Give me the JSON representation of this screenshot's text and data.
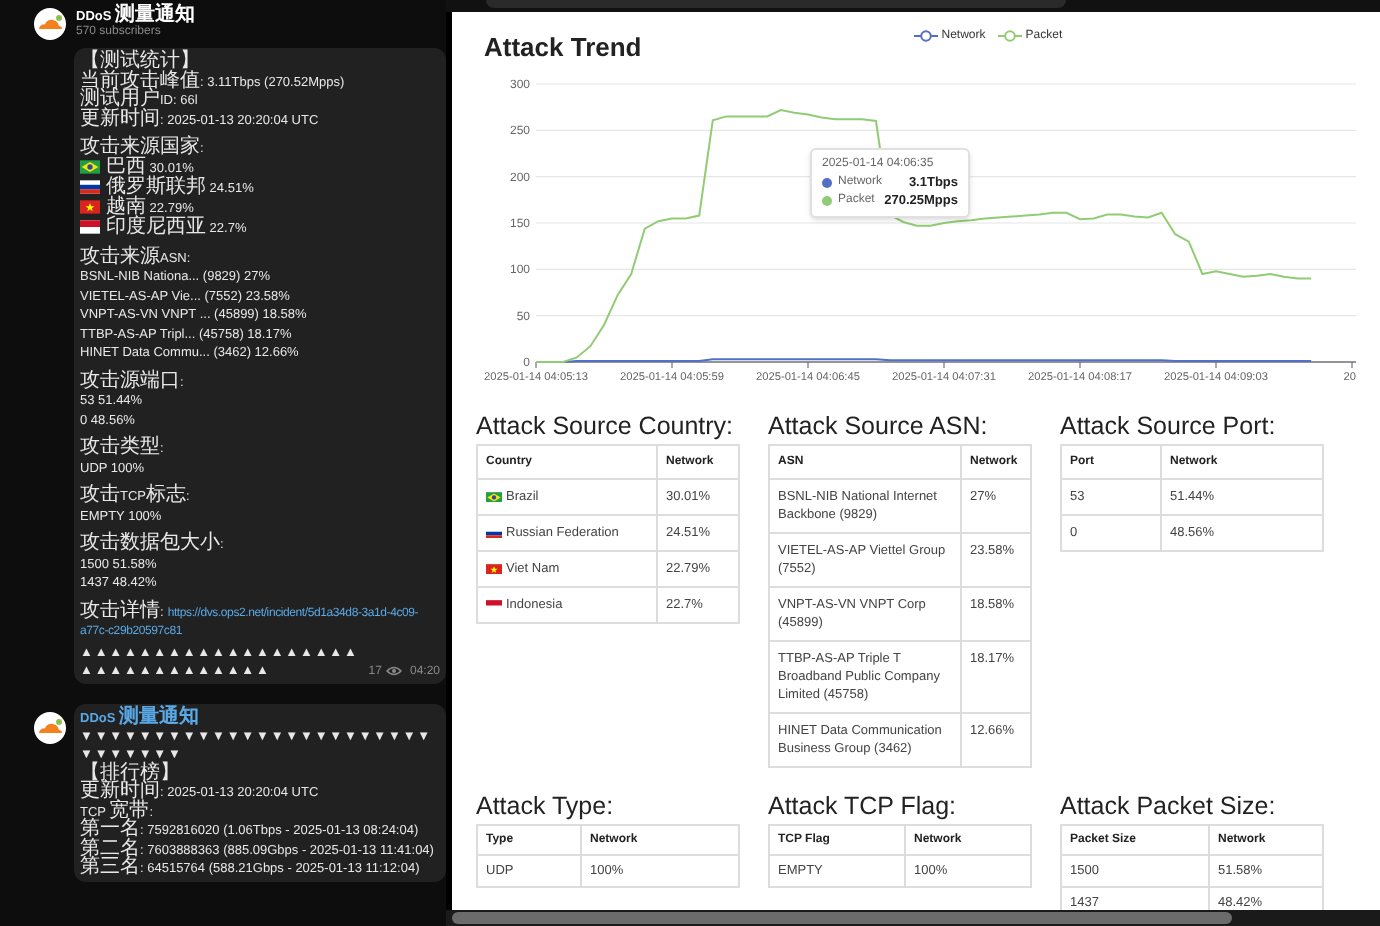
{
  "chat": {
    "channel": {
      "name": "DDoS 测量通知",
      "subscribers": "570 subscribers"
    },
    "messages": [
      {
        "sections": [
          [
            {
              "text": "【测试统计】"
            },
            {
              "text": "当前攻击峰值: 3.11Tbps (270.52Mpps)"
            },
            {
              "text": "测试用户ID: 66l"
            },
            {
              "text": "更新时间: 2025-01-13 20:20:04 UTC"
            }
          ],
          [
            {
              "text": "攻击来源国家:"
            },
            {
              "text": "巴西 30.01%",
              "kind": "brazil"
            },
            {
              "text": "俄罗斯联邦 24.51%",
              "kind": "russia"
            },
            {
              "text": "越南 22.79%",
              "kind": "vietnam"
            },
            {
              "text": "印度尼西亚 22.7%",
              "kind": "indonesia"
            }
          ],
          [
            {
              "text": "攻击来源ASN:"
            },
            {
              "text": "BSNL-NIB Nationa... (9829) 27%"
            },
            {
              "text": "VIETEL-AS-AP Vie... (7552) 23.58%"
            },
            {
              "text": "VNPT-AS-VN VNPT ... (45899) 18.58%"
            },
            {
              "text": "TTBP-AS-AP Tripl... (45758) 18.17%"
            },
            {
              "text": "HINET Data Commu... (3462) 12.66%"
            }
          ],
          [
            {
              "text": "攻击源端口:"
            },
            {
              "text": "53 51.44%"
            },
            {
              "text": "0 48.56%"
            }
          ],
          [
            {
              "text": "攻击类型:"
            },
            {
              "text": "UDP 100%"
            }
          ],
          [
            {
              "text": "攻击TCP标志:"
            },
            {
              "text": "EMPTY 100%"
            }
          ],
          [
            {
              "text": "攻击数据包大小:"
            },
            {
              "text": "1500 51.58%"
            },
            {
              "text": "1437 48.42%"
            }
          ],
          [
            {
              "text": "攻击详情:",
              "link": [
                "https://dvs.ops2.net/incident/5d1a34d8-3a1d-4c09-",
                "a77c-c29b20597c81"
              ]
            },
            {
              "text": "▲▲▲▲▲▲▲▲▲▲▲▲▲▲▲▲▲▲▲▲▲▲▲▲▲▲▲▲▲▲▲▲"
            }
          ]
        ],
        "views": "17",
        "time": "04:20"
      },
      {
        "author": "DDoS 测量通知",
        "sections": [
          [
            {
              "text": "▼▼▼▼▼▼▼▼▼▼▼▼▼▼▼▼▼▼▼▼▼▼▼▼▼▼▼▼▼▼▼"
            },
            {
              "text": "【排行榜】"
            },
            {
              "text": "更新时间: 2025-01-13 20:20:04 UTC"
            },
            {
              "text": "TCP 宽带:"
            },
            {
              "text": "第一名: 7592816020 (1.06Tbps - 2025-01-13 08:24:04)"
            },
            {
              "text": "第二名: 7603888363 (885.09Gbps - 2025-01-13 11:41:04)"
            },
            {
              "text": "第三名: 64515764 (588.21Gbps - 2025-01-13 11:12:04)"
            }
          ]
        ]
      }
    ]
  },
  "report": {
    "trend": {
      "title": "Attack Trend",
      "chart_data": {
        "type": "line",
        "categories": [
          "2025-01-14 04:05:13",
          null,
          null,
          null,
          null,
          null,
          null,
          null,
          null,
          null,
          "2025-01-14 04:05:59",
          null,
          null,
          null,
          null,
          null,
          null,
          null,
          null,
          null,
          "2025-01-14 04:06:45",
          null,
          null,
          null,
          null,
          null,
          null,
          null,
          null,
          null,
          "2025-01-14 04:07:31",
          null,
          null,
          null,
          null,
          null,
          null,
          null,
          null,
          null,
          "2025-01-14 04:08:17",
          null,
          null,
          null,
          null,
          null,
          null,
          null,
          null,
          null,
          "2025-01-14 04:09:03",
          null,
          null,
          null,
          null,
          null,
          null,
          null,
          null,
          null,
          "20"
        ],
        "series": [
          {
            "name": "Network",
            "color": "#5470c6",
            "values": [
              0,
              0,
              0,
              1,
              1,
              1,
              1,
              1,
              1,
              1,
              1,
              1,
              1,
              3,
              3,
              3,
              3,
              3,
              3,
              3,
              3,
              3,
              3,
              3,
              3,
              3,
              2,
              2,
              2,
              2,
              2,
              2,
              2,
              2,
              2,
              2,
              2,
              2,
              2,
              2,
              2,
              2,
              2,
              2,
              2,
              2,
              2,
              1,
              1,
              1,
              1,
              1,
              1,
              1,
              1,
              1,
              1,
              1,
              null,
              null,
              null
            ]
          },
          {
            "name": "Packet",
            "color": "#91cc75",
            "values": [
              0,
              0,
              0,
              5,
              17,
              40,
              72,
              95,
              144,
              152,
              155,
              155,
              158,
              261,
              265,
              265,
              265,
              265,
              272,
              269,
              267,
              264,
              262,
              262,
              262,
              260,
              159,
              151,
              147,
              147,
              150,
              152,
              153,
              155,
              156,
              157,
              158,
              159,
              161,
              161,
              154,
              155,
              159,
              159,
              157,
              156,
              161,
              138,
              130,
              95,
              98,
              95,
              92,
              93,
              95,
              92,
              90,
              90,
              null,
              null,
              null
            ]
          }
        ],
        "ylim": [
          0,
          300
        ],
        "yticks": [
          0,
          50,
          100,
          150,
          200,
          250,
          300
        ],
        "grid": true,
        "legend": true
      },
      "tooltip": {
        "time": "2025-01-14 04:06:35",
        "items": [
          {
            "name": "Network",
            "value": "3.1Tbps",
            "color": "#5470c6"
          },
          {
            "name": "Packet",
            "value": "270.25Mpps",
            "color": "#91cc75"
          }
        ]
      }
    },
    "tables": [
      {
        "title": "Attack Source Country:",
        "columns": [
          "Country",
          "Network"
        ],
        "rows": [
          {
            "cells": [
              "Brazil",
              "30.01%"
            ],
            "kind": "brazil"
          },
          {
            "cells": [
              "Russian Federation",
              "24.51%"
            ],
            "kind": "russia"
          },
          {
            "cells": [
              "Viet Nam",
              "22.79%"
            ],
            "kind": "vietnam"
          },
          {
            "cells": [
              "Indonesia",
              "22.7%"
            ],
            "kind": "indonesia"
          }
        ]
      },
      {
        "title": "Attack Source ASN:",
        "columns": [
          "ASN",
          "Network"
        ],
        "rows": [
          {
            "cells": [
              "BSNL-NIB National Internet Backbone (9829)",
              "27%"
            ]
          },
          {
            "cells": [
              "VIETEL-AS-AP Viettel Group (7552)",
              "23.58%"
            ]
          },
          {
            "cells": [
              "VNPT-AS-VN VNPT Corp (45899)",
              "18.58%"
            ]
          },
          {
            "cells": [
              "TTBP-AS-AP Triple T Broadband Public Company Limited (45758)",
              "18.17%"
            ]
          },
          {
            "cells": [
              "HINET Data Communication Business Group (3462)",
              "12.66%"
            ]
          }
        ]
      },
      {
        "title": "Attack Source Port:",
        "columns": [
          "Port",
          "Network"
        ],
        "rows": [
          {
            "cells": [
              "53",
              "51.44%"
            ]
          },
          {
            "cells": [
              "0",
              "48.56%"
            ]
          }
        ]
      },
      {
        "title": "Attack Type:",
        "columns": [
          "Type",
          "Network"
        ],
        "rows": [
          {
            "cells": [
              "UDP",
              "100%"
            ]
          }
        ]
      },
      {
        "title": "Attack TCP Flag:",
        "columns": [
          "TCP Flag",
          "Network"
        ],
        "rows": [
          {
            "cells": [
              "EMPTY",
              "100%"
            ]
          }
        ]
      },
      {
        "title": "Attack Packet Size:",
        "columns": [
          "Packet Size",
          "Network"
        ],
        "rows": [
          {
            "cells": [
              "1500",
              "51.58%"
            ]
          },
          {
            "cells": [
              "1437",
              "48.42%"
            ]
          }
        ]
      }
    ]
  }
}
